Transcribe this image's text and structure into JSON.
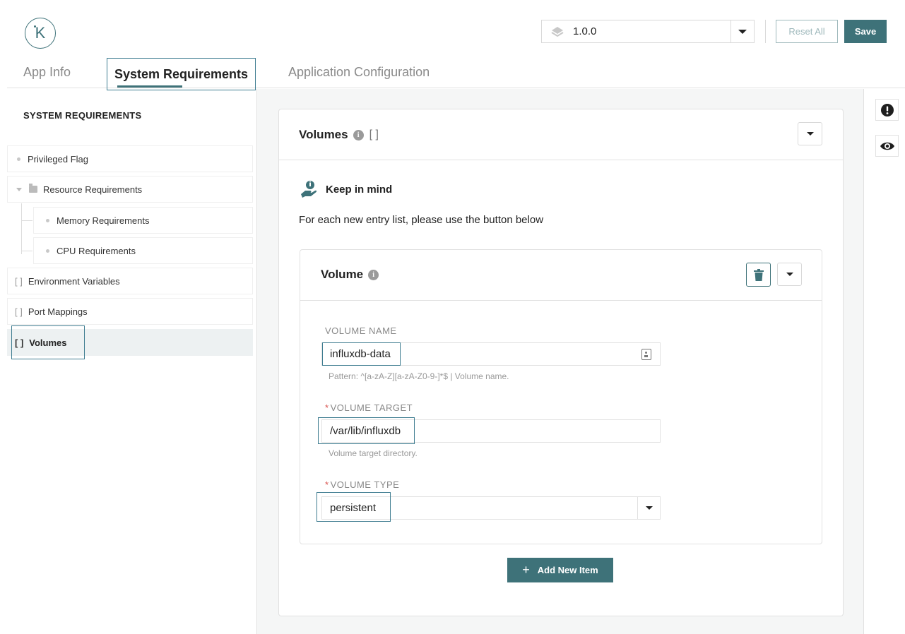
{
  "header": {
    "logo_letter": "K",
    "version": "1.0.0",
    "reset_label": "Reset All",
    "save_label": "Save"
  },
  "tabs": [
    {
      "label": "App Info"
    },
    {
      "label": "System Requirements",
      "active": true
    },
    {
      "label": "Application Configuration"
    }
  ],
  "sidebar": {
    "title": "SYSTEM REQUIREMENTS",
    "items": [
      {
        "label": "Privileged Flag",
        "kind": "leaf"
      },
      {
        "label": "Resource Requirements",
        "kind": "group"
      },
      {
        "label": "Memory Requirements",
        "kind": "leaf"
      },
      {
        "label": "CPU Requirements",
        "kind": "leaf"
      },
      {
        "label": "Environment Variables",
        "kind": "array"
      },
      {
        "label": "Port Mappings",
        "kind": "array"
      },
      {
        "label": "Volumes",
        "kind": "array",
        "active": true
      }
    ],
    "array_marker": "[ ]"
  },
  "card": {
    "title": "Volumes",
    "title_suffix": "[ ]",
    "info_glyph": "i",
    "keep_title": "Keep in mind",
    "keep_text": "For each new entry list, please use the button below"
  },
  "volume": {
    "title": "Volume",
    "fields": {
      "name": {
        "label": "VOLUME NAME",
        "value": "influxdb-data",
        "help": "Pattern: ^[a-zA-Z][a-zA-Z0-9-]*$ | Volume name."
      },
      "target": {
        "label": "VOLUME TARGET",
        "required_mark": "*",
        "value": "/var/lib/influxdb",
        "help": "Volume target directory."
      },
      "type": {
        "label": "VOLUME TYPE",
        "required_mark": "*",
        "value": "persistent"
      }
    }
  },
  "add_button": {
    "plus": "+",
    "label": "Add New Item"
  },
  "colors": {
    "accent": "#3e7279",
    "highlight": "#3e7c90",
    "required": "#d9534f"
  },
  "icons": {
    "rail_top": "exclamation-circle-icon",
    "rail_bottom": "eye-icon",
    "keep": "hand-info-icon",
    "delete": "trash-icon",
    "version": "layers-icon"
  }
}
